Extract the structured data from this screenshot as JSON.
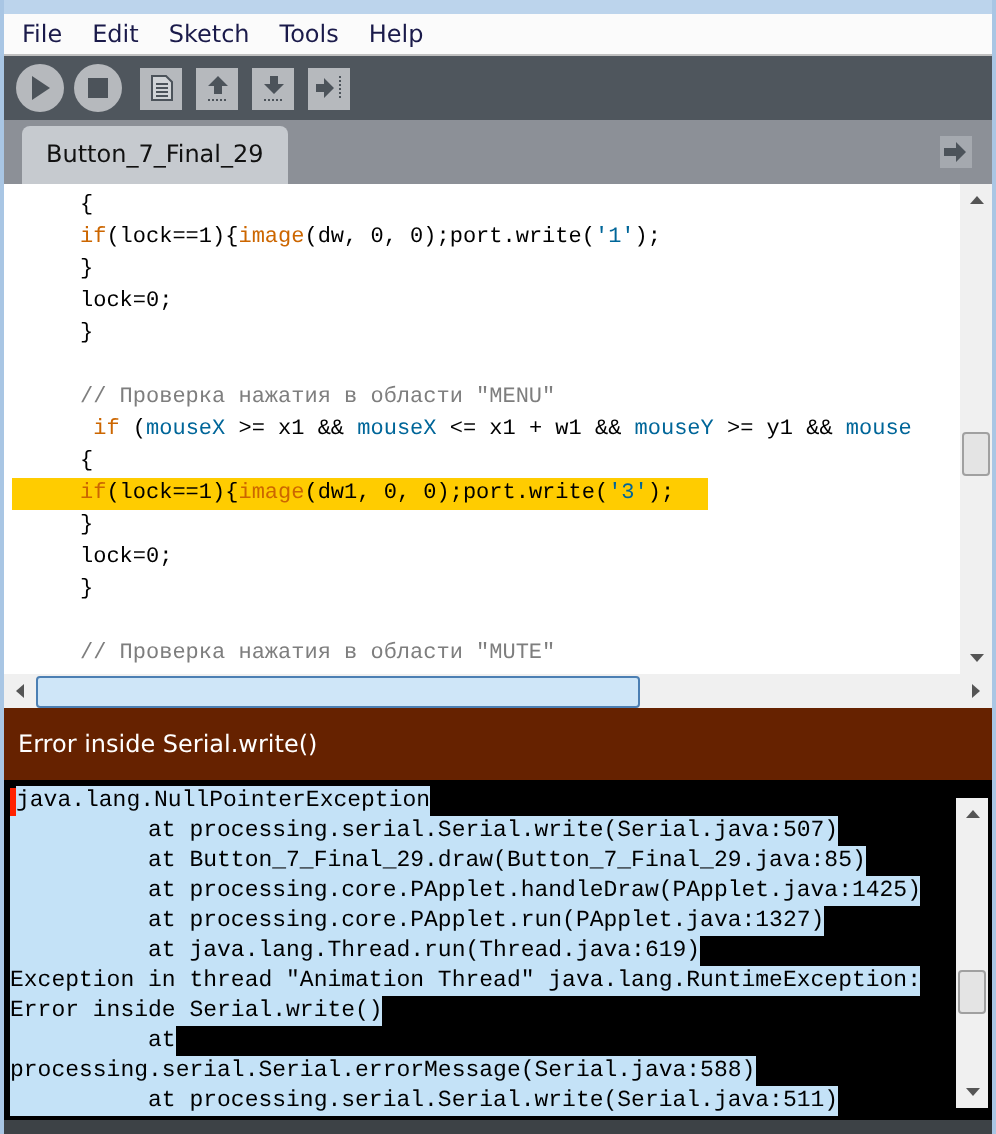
{
  "menu": [
    "File",
    "Edit",
    "Sketch",
    "Tools",
    "Help"
  ],
  "toolbar": [
    {
      "kind": "run"
    },
    {
      "kind": "stop"
    },
    {
      "kind": "new"
    },
    {
      "kind": "open"
    },
    {
      "kind": "save"
    },
    {
      "kind": "export"
    }
  ],
  "tabs": [
    {
      "label": "Button_7_Final_29",
      "selected": true
    }
  ],
  "editor": {
    "lines": [
      {
        "highlighted": false,
        "tokens": [
          {
            "kind": "plain",
            "text": "{"
          }
        ]
      },
      {
        "highlighted": false,
        "tokens": [
          {
            "kind": "keyword",
            "text": "if"
          },
          {
            "kind": "plain",
            "text": "(lock==1){"
          },
          {
            "kind": "keyword",
            "text": "image"
          },
          {
            "kind": "plain",
            "text": "(dw, 0, 0);port.write("
          },
          {
            "kind": "string",
            "text": "'1'"
          },
          {
            "kind": "plain",
            "text": ");"
          }
        ]
      },
      {
        "highlighted": false,
        "tokens": [
          {
            "kind": "plain",
            "text": "}"
          }
        ]
      },
      {
        "highlighted": false,
        "tokens": [
          {
            "kind": "plain",
            "text": "lock=0;"
          }
        ]
      },
      {
        "highlighted": false,
        "tokens": [
          {
            "kind": "plain",
            "text": "}"
          }
        ]
      },
      {
        "highlighted": false
      },
      {
        "highlighted": false,
        "tokens": [
          {
            "kind": "comment",
            "text": "// Проверка нажатия в области \"MENU\""
          }
        ]
      },
      {
        "highlighted": false,
        "tokens": [
          {
            "kind": "keyword",
            "text": " if"
          },
          {
            "kind": "plain",
            "text": " ("
          },
          {
            "kind": "variable",
            "text": "mouseX"
          },
          {
            "kind": "plain",
            "text": " >= x1 && "
          },
          {
            "kind": "variable",
            "text": "mouseX"
          },
          {
            "kind": "plain",
            "text": " <= x1 + w1 && "
          },
          {
            "kind": "variable",
            "text": "mouseY"
          },
          {
            "kind": "plain",
            "text": " >= y1 && "
          },
          {
            "kind": "variable",
            "text": "mouse"
          }
        ]
      },
      {
        "highlighted": false,
        "tokens": [
          {
            "kind": "plain",
            "text": "{"
          }
        ]
      },
      {
        "highlighted": true,
        "tokens": [
          {
            "kind": "keyword",
            "text": "if"
          },
          {
            "kind": "plain",
            "text": "(lock==1){"
          },
          {
            "kind": "keyword",
            "text": "image"
          },
          {
            "kind": "plain",
            "text": "(dw1, 0, 0);port.write("
          },
          {
            "kind": "string",
            "text": "'3'"
          },
          {
            "kind": "plain",
            "text": ");"
          }
        ]
      },
      {
        "highlighted": false,
        "tokens": [
          {
            "kind": "plain",
            "text": "}"
          }
        ]
      },
      {
        "highlighted": false,
        "tokens": [
          {
            "kind": "plain",
            "text": "lock=0;"
          }
        ]
      },
      {
        "highlighted": false,
        "tokens": [
          {
            "kind": "plain",
            "text": "}"
          }
        ]
      },
      {
        "highlighted": false
      },
      {
        "highlighted": false,
        "tokens": [
          {
            "kind": "comment",
            "text": "// Проверка нажатия в области \"MUTE\""
          }
        ]
      }
    ]
  },
  "status": {
    "message": "Error inside Serial.write()"
  },
  "console": {
    "lines": [
      {
        "text": "java.lang.NullPointerException",
        "selected": true
      },
      {
        "text": "          at processing.serial.Serial.write(Serial.java:507)",
        "selected": true
      },
      {
        "text": "          at Button_7_Final_29.draw(Button_7_Final_29.java:85)",
        "selected": true
      },
      {
        "text": "          at processing.core.PApplet.handleDraw(PApplet.java:1425)",
        "selected": true
      },
      {
        "text": "          at processing.core.PApplet.run(PApplet.java:1327)",
        "selected": true
      },
      {
        "text": "          at java.lang.Thread.run(Thread.java:619)",
        "selected": true
      },
      {
        "text": "Exception in thread \"Animation Thread\" java.lang.RuntimeException:",
        "selected": true
      },
      {
        "text": "Error inside Serial.write()",
        "selected": true
      },
      {
        "text": "          at",
        "selected": true
      },
      {
        "text": "processing.serial.Serial.errorMessage(Serial.java:588)",
        "selected": true
      },
      {
        "text": "          at processing.serial.Serial.write(Serial.java:511)",
        "selected": true
      }
    ]
  }
}
